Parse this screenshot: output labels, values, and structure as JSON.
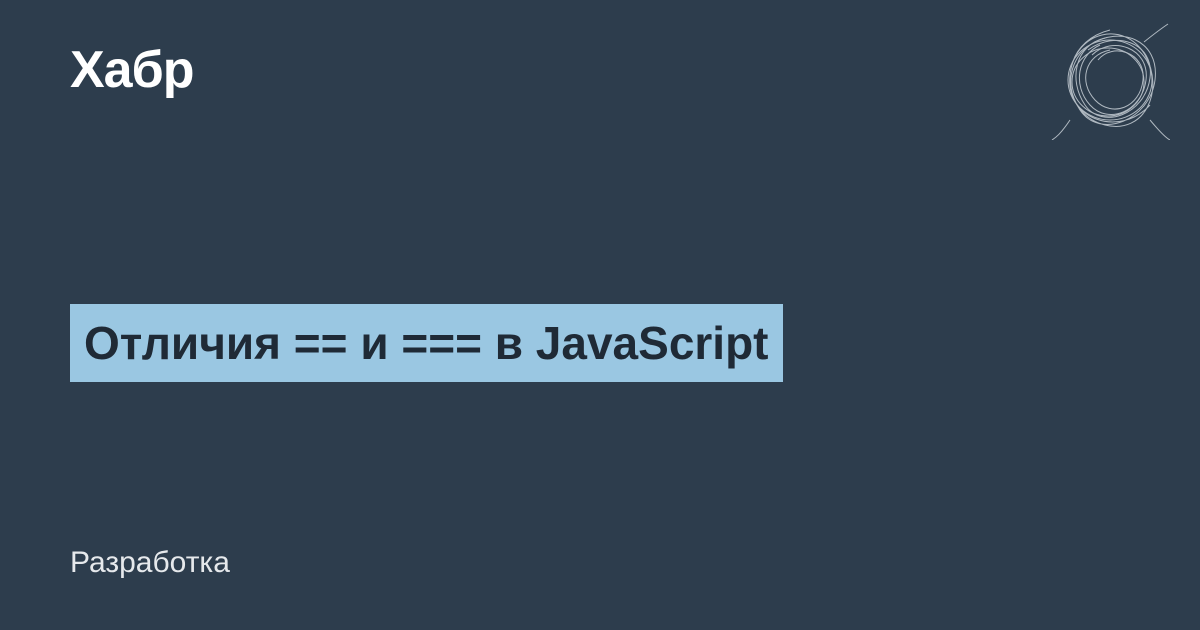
{
  "header": {
    "logo": "Хабр"
  },
  "article": {
    "title": "Отличия == и === в JavaScript"
  },
  "footer": {
    "category": "Разработка"
  },
  "colors": {
    "bg": "#2d3d4d",
    "accent": "#9ac7e2",
    "text_dark": "#1f2a36",
    "text_light": "#ffffff"
  }
}
